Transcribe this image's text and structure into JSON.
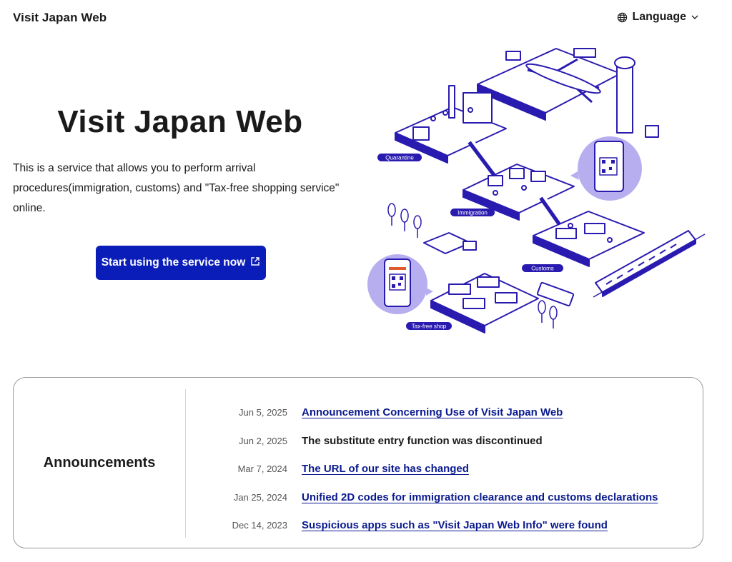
{
  "header": {
    "site_title": "Visit Japan Web",
    "language_label": "Language",
    "language_icon": "globe-icon",
    "dropdown_icon": "chevron-down-icon"
  },
  "hero": {
    "title": "Visit Japan Web",
    "description": "This is a service that allows you to perform arrival procedures(immigration, customs) and \"Tax-free shopping service\" online.",
    "cta_label": "Start using the service now",
    "cta_icon": "external-link-icon"
  },
  "illustration": {
    "labels": {
      "quarantine": "Quarantine",
      "immigration": "Immigration",
      "customs": "Customs",
      "taxfree": "Tax-free shop"
    }
  },
  "announcements": {
    "title": "Announcements",
    "items": [
      {
        "date": "Jun 5, 2025",
        "text": "Announcement Concerning Use of Visit Japan Web",
        "is_link": true
      },
      {
        "date": "Jun 2, 2025",
        "text": "The substitute entry function was discontinued",
        "is_link": false
      },
      {
        "date": "Mar 7, 2024",
        "text": "The URL of our site has changed",
        "is_link": true
      },
      {
        "date": "Jan 25, 2024",
        "text": "Unified 2D codes for immigration clearance and customs declarations",
        "is_link": true
      },
      {
        "date": "Dec 14, 2023",
        "text": "Suspicious apps such as \"Visit Japan Web Info\" were found",
        "is_link": true
      }
    ]
  },
  "colors": {
    "brand_blue": "#0a1db8",
    "link_blue": "#0a1a8f",
    "illustration_blue": "#2a1bb0",
    "illustration_lavender": "#b7aef0"
  }
}
